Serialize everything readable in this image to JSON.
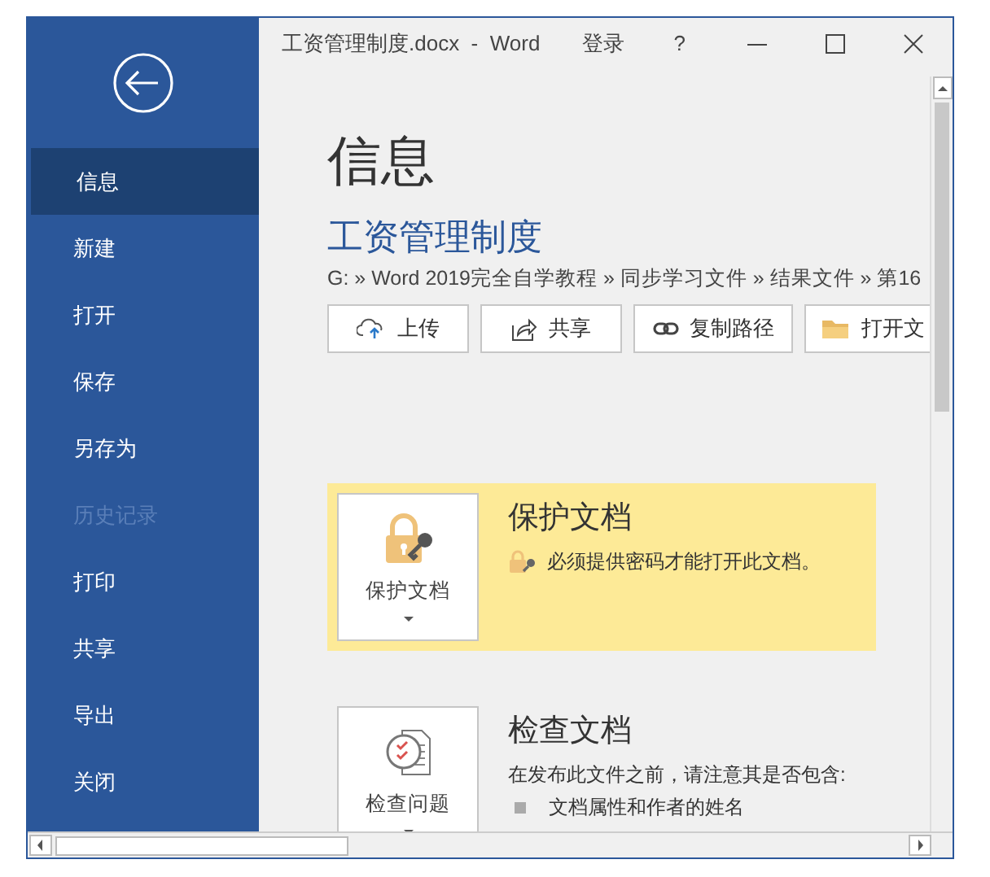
{
  "window": {
    "title": "工资管理制度.docx  -  Word",
    "sign_in": "登录",
    "help": "?"
  },
  "sidebar": {
    "items": [
      {
        "label": "信息",
        "selected": true,
        "disabled": false
      },
      {
        "label": "新建",
        "selected": false,
        "disabled": false
      },
      {
        "label": "打开",
        "selected": false,
        "disabled": false
      },
      {
        "label": "保存",
        "selected": false,
        "disabled": false
      },
      {
        "label": "另存为",
        "selected": false,
        "disabled": false
      },
      {
        "label": "历史记录",
        "selected": false,
        "disabled": true
      },
      {
        "label": "打印",
        "selected": false,
        "disabled": false
      },
      {
        "label": "共享",
        "selected": false,
        "disabled": false
      },
      {
        "label": "导出",
        "selected": false,
        "disabled": false
      },
      {
        "label": "关闭",
        "selected": false,
        "disabled": false
      }
    ]
  },
  "info": {
    "heading": "信息",
    "doc_title": "工资管理制度",
    "path": "G: » Word 2019完全自学教程 » 同步学习文件 » 结果文件 » 第16",
    "actions": [
      {
        "kind": "upload",
        "label": "上传"
      },
      {
        "kind": "share",
        "label": "共享"
      },
      {
        "kind": "link",
        "label": "复制路径"
      },
      {
        "kind": "folder",
        "label": "打开文"
      }
    ],
    "sections": [
      {
        "kind": "protect",
        "highlighted": true,
        "button_label": "保护文档",
        "title": "保护文档",
        "description": "必须提供密码才能打开此文档。"
      },
      {
        "kind": "inspect",
        "highlighted": false,
        "button_label": "检查问题",
        "title": "检查文档",
        "description": "在发布此文件之前，请注意其是否包含:",
        "bullets": [
          "文档属性和作者的姓名"
        ]
      }
    ]
  }
}
